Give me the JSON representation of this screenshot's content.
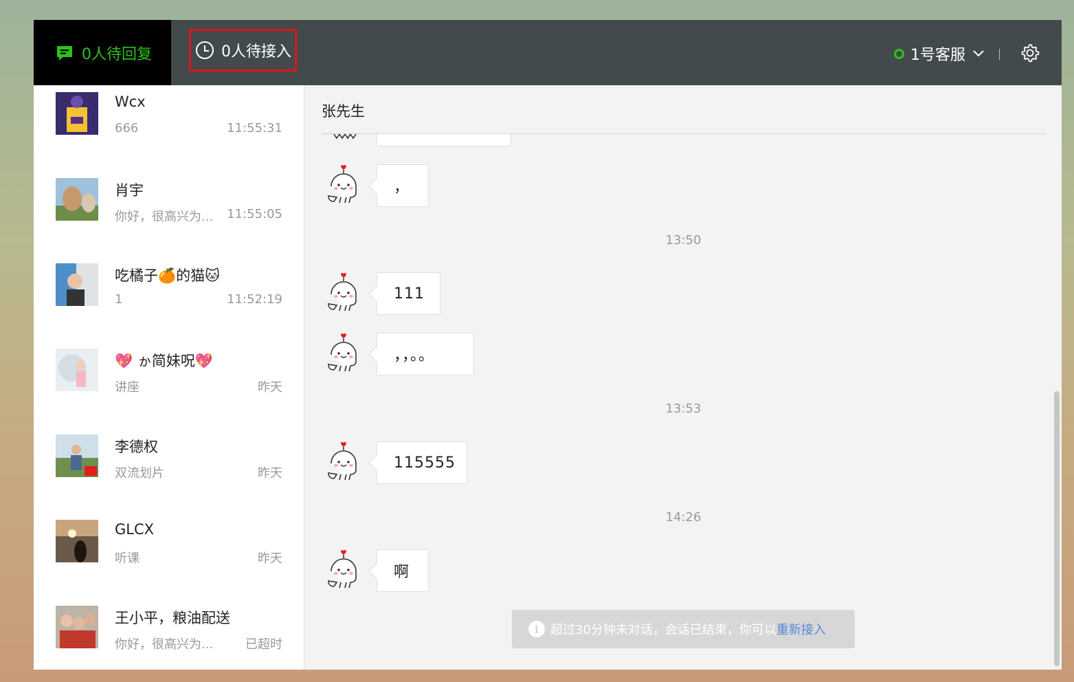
{
  "topbar": {
    "reply_tab": "0人待回复",
    "pending_tab": "0人待接入",
    "agent_name": "1号客服"
  },
  "conversations": [
    {
      "name": "Wcx",
      "preview": "666",
      "time": "11:55:31"
    },
    {
      "name": "肖宇",
      "preview": "你好，很高兴为...",
      "time": "11:55:05"
    },
    {
      "name": "吃橘子🍊的猫🐱",
      "preview": "1",
      "time": "11:52:19"
    },
    {
      "name": "💖 ゕ简妹呪💖",
      "preview": "讲座",
      "time": "昨天"
    },
    {
      "name": "李德权",
      "preview": "双流划片",
      "time": "昨天"
    },
    {
      "name": "GLCX",
      "preview": "听课",
      "time": "昨天"
    },
    {
      "name": "王小平，粮油配送",
      "preview": "你好，很高兴为...",
      "time": "已超时"
    }
  ],
  "chat": {
    "title": "张先生",
    "messages": [
      {
        "text": "，"
      },
      {
        "timestamp": "13:50"
      },
      {
        "text": "111"
      },
      {
        "text": "，，。。"
      },
      {
        "timestamp": "13:53"
      },
      {
        "text": "115555"
      },
      {
        "timestamp": "14:26"
      },
      {
        "text": "啊"
      }
    ],
    "notice_text": "超过30分钟未对话，会话已结束，你可以",
    "notice_link": "重新接入"
  },
  "colors": {
    "accent_green": "#2dc21b",
    "topbar": "#434a4c",
    "highlight_border": "#e0141b",
    "link_blue": "#5a89d6"
  }
}
